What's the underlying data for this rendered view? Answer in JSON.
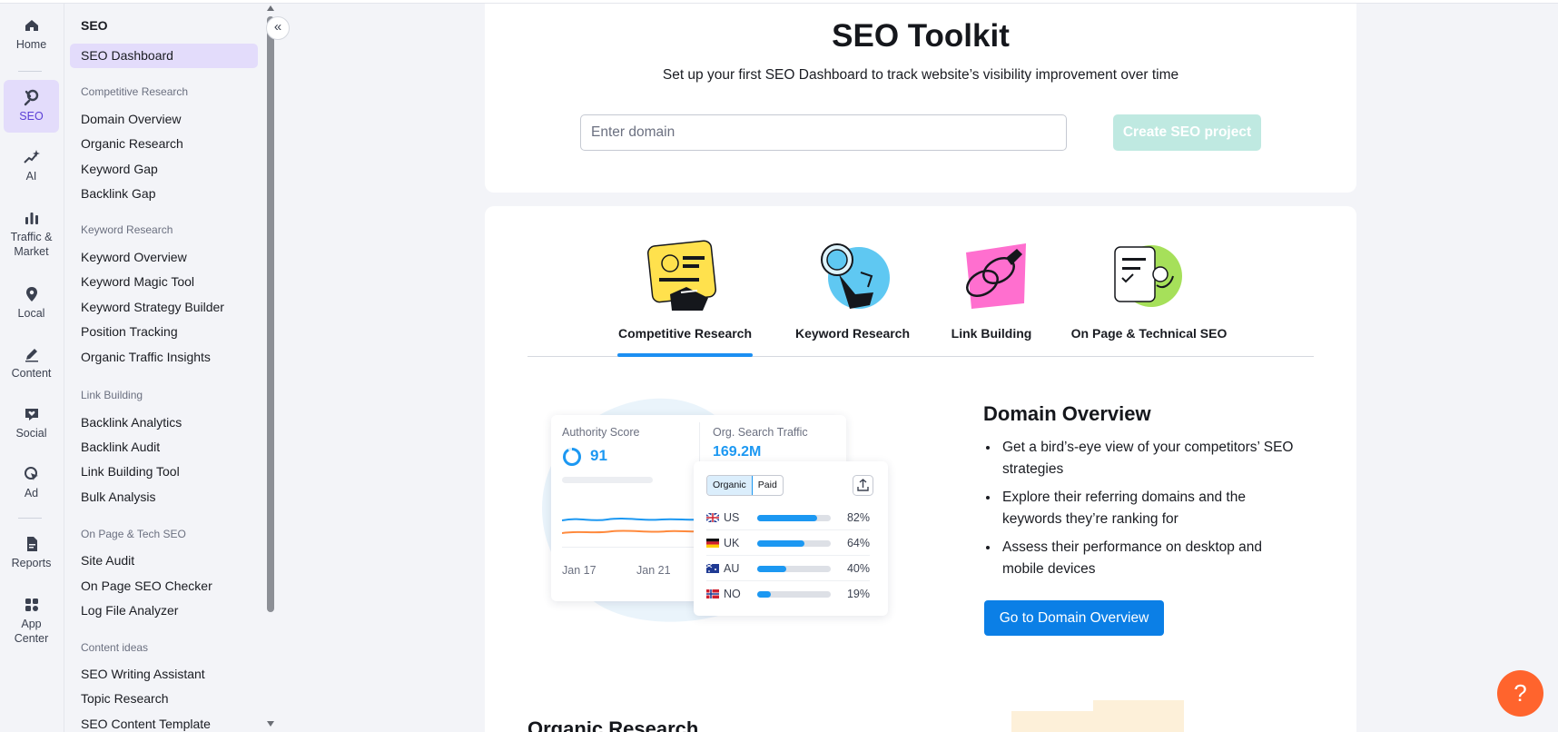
{
  "rail": {
    "items": [
      {
        "label": "Home",
        "icon": "home-icon"
      },
      {
        "label": "SEO",
        "icon": "seo-icon",
        "active": true
      },
      {
        "label": "AI",
        "icon": "ai-sparkle-icon"
      },
      {
        "label": "Traffic & Market",
        "icon": "bar-chart-icon"
      },
      {
        "label": "Local",
        "icon": "location-pin-icon"
      },
      {
        "label": "Content",
        "icon": "pen-icon"
      },
      {
        "label": "Social",
        "icon": "chat-heart-icon"
      },
      {
        "label": "Ad",
        "icon": "cursor-click-icon"
      },
      {
        "label": "Reports",
        "icon": "report-icon"
      },
      {
        "label": "App Center",
        "icon": "apps-grid-icon"
      }
    ]
  },
  "nav": {
    "title": "SEO",
    "dashboard": "SEO Dashboard",
    "sections": [
      {
        "heading": "Competitive Research",
        "items": [
          "Domain Overview",
          "Organic Research",
          "Keyword Gap",
          "Backlink Gap"
        ]
      },
      {
        "heading": "Keyword Research",
        "items": [
          "Keyword Overview",
          "Keyword Magic Tool",
          "Keyword Strategy Builder",
          "Position Tracking",
          "Organic Traffic Insights"
        ]
      },
      {
        "heading": "Link Building",
        "items": [
          "Backlink Analytics",
          "Backlink Audit",
          "Link Building Tool",
          "Bulk Analysis"
        ]
      },
      {
        "heading": "On Page & Tech SEO",
        "items": [
          "Site Audit",
          "On Page SEO Checker",
          "Log File Analyzer"
        ]
      },
      {
        "heading": "Content ideas",
        "items": [
          "SEO Writing Assistant",
          "Topic Research",
          "SEO Content Template"
        ]
      }
    ],
    "collapse_label": "«"
  },
  "toolkit": {
    "title": "SEO Toolkit",
    "subtitle": "Set up your first SEO Dashboard to track website’s visibility improvement over time",
    "input_placeholder": "Enter domain",
    "input_value": "",
    "create_button": "Create SEO project"
  },
  "tabs": [
    {
      "label": "Competitive Research",
      "active": true
    },
    {
      "label": "Keyword Research"
    },
    {
      "label": "Link Building"
    },
    {
      "label": "On Page & Technical SEO"
    }
  ],
  "illustration": {
    "authority_label": "Authority Score",
    "authority_value": "91",
    "traffic_label": "Org. Search Traffic",
    "traffic_value": "169.2M",
    "x_labels": [
      "Jan 17",
      "Jan 21"
    ],
    "toggle": [
      "Organic",
      "Paid"
    ],
    "countries": [
      {
        "code": "US",
        "pct": "82%",
        "value": 0.82
      },
      {
        "code": "UK",
        "pct": "64%",
        "value": 0.64
      },
      {
        "code": "AU",
        "pct": "40%",
        "value": 0.4
      },
      {
        "code": "NO",
        "pct": "19%",
        "value": 0.19
      }
    ]
  },
  "domain_overview": {
    "title": "Domain Overview",
    "bullets": [
      "Get a bird’s-eye view of your competitors’ SEO strategies",
      "Explore their referring domains and the keywords they’re ranking for",
      "Assess their performance on desktop and mobile devices"
    ],
    "button": "Go to Domain Overview"
  },
  "next_section_title": "Organic Research",
  "help_label": "?",
  "colors": {
    "accent": "#0b7fe6",
    "active_bg": "#e3dcfb",
    "help": "#ff642d",
    "create_disabled": "#bfe9e1"
  }
}
